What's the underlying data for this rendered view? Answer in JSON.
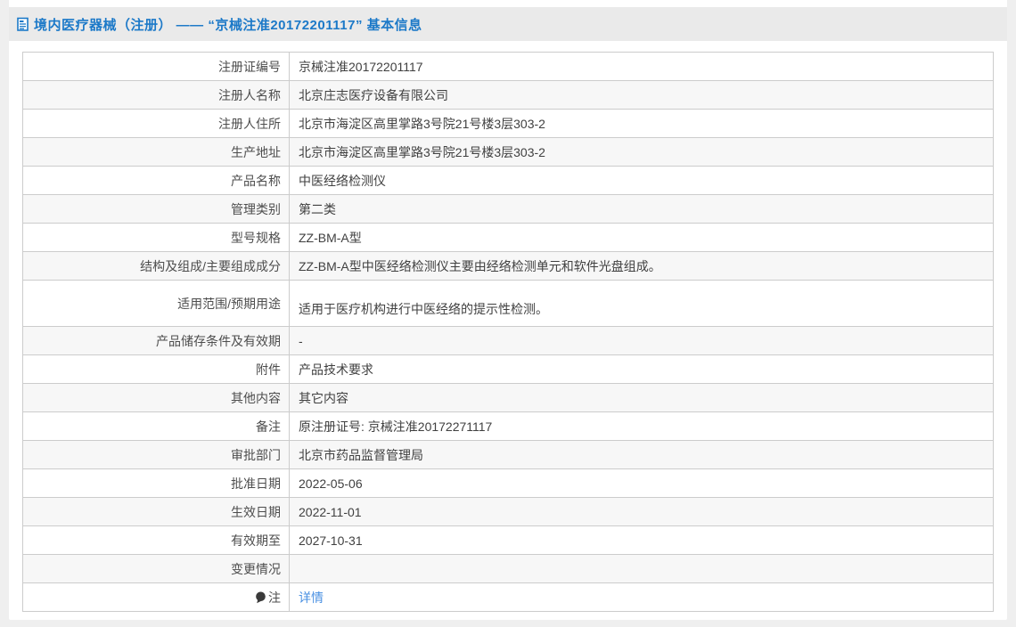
{
  "header": {
    "title": "境内医疗器械（注册） —— “京械注准20172201117” 基本信息",
    "icon": "document-icon"
  },
  "colors": {
    "title_blue": "#1c79c8",
    "link_blue": "#4a90e2",
    "header_bar_bg": "#eaeaea",
    "stripe_bg": "#f7f7f7",
    "table_border": "#cccccc",
    "page_bg": "#efefef"
  },
  "table": {
    "rows": [
      {
        "label": "注册证编号",
        "value": "京械注准20172201117"
      },
      {
        "label": "注册人名称",
        "value": "北京庄志医疗设备有限公司"
      },
      {
        "label": "注册人住所",
        "value": "北京市海淀区高里掌路3号院21号楼3层303-2"
      },
      {
        "label": "生产地址",
        "value": "北京市海淀区高里掌路3号院21号楼3层303-2"
      },
      {
        "label": "产品名称",
        "value": "中医经络检测仪"
      },
      {
        "label": "管理类别",
        "value": "第二类"
      },
      {
        "label": "型号规格",
        "value": "ZZ-BM-A型"
      },
      {
        "label": "结构及组成/主要组成成分",
        "value": "ZZ-BM-A型中医经络检测仪主要由经络检测单元和软件光盘组成。"
      },
      {
        "label": "适用范围/预期用途",
        "value": "适用于医疗机构进行中医经络的提示性检测。"
      },
      {
        "label": "产品储存条件及有效期",
        "value": "-"
      },
      {
        "label": "附件",
        "value": "产品技术要求"
      },
      {
        "label": "其他内容",
        "value": "其它内容"
      },
      {
        "label": "备注",
        "value": "原注册证号: 京械注准20172271117"
      },
      {
        "label": "审批部门",
        "value": "北京市药品监督管理局"
      },
      {
        "label": "批准日期",
        "value": "2022-05-06"
      },
      {
        "label": "生效日期",
        "value": "2022-11-01"
      },
      {
        "label": "有效期至",
        "value": "2027-10-31"
      },
      {
        "label": "变更情况",
        "value": ""
      },
      {
        "label": "注",
        "value": "详情",
        "label_icon": "balloon-icon",
        "value_link": true
      }
    ]
  }
}
